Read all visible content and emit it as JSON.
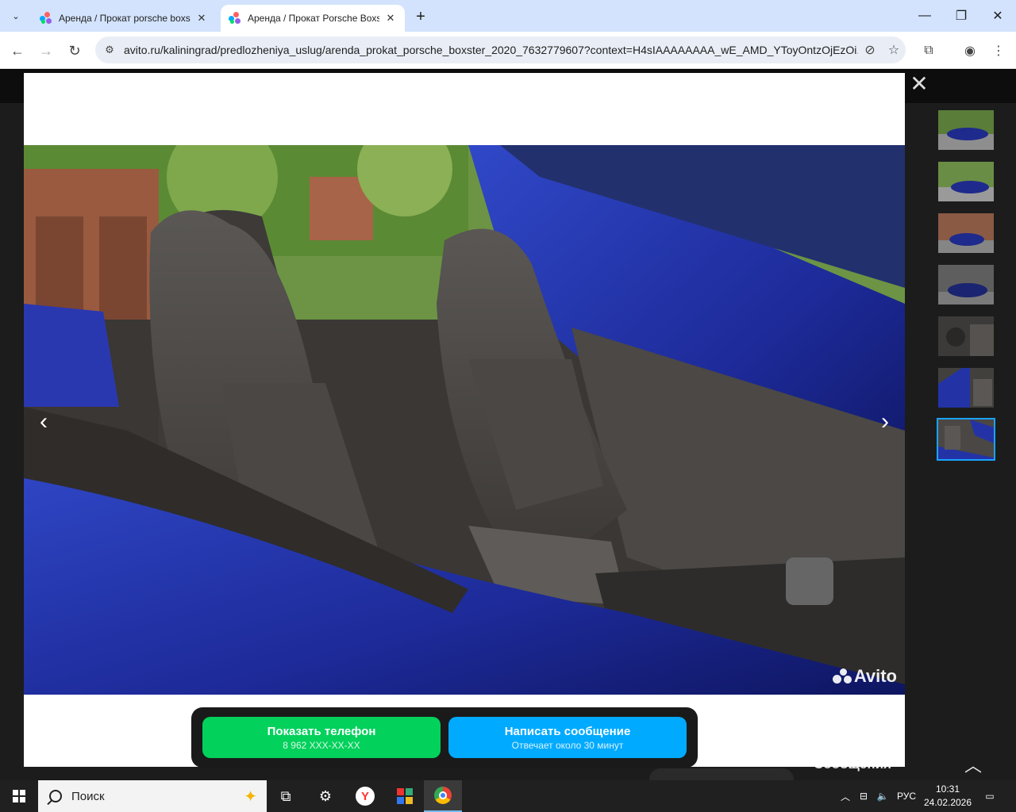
{
  "browser": {
    "tabs": [
      {
        "title": "Аренда / Прокат porsche boxster",
        "active": false
      },
      {
        "title": "Аренда / Прокат Porsche Boxster",
        "active": true
      }
    ],
    "url": "avito.ru/kaliningrad/predlozheniya_uslug/arenda_prokat_porsche_boxster_2020_7632779607?context=H4sIAAAAAAAA_wE_AMD_YToyOntzOjEzOi..."
  },
  "viewer": {
    "thumbnail_count": 7,
    "selected_thumbnail": 7,
    "watermark": "Avito",
    "photo_colors": {
      "body": "#2230a8",
      "leather": "#4a4744",
      "foliage": "#5c8a3a",
      "brick": "#9a5a40"
    }
  },
  "cta": {
    "phone_label": "Показать телефон",
    "phone_sub": "8 962 XXX-XX-XX",
    "message_label": "Написать сообщение",
    "message_sub": "Отвечает около 30 минут"
  },
  "background": {
    "messages_label": "Сообщения"
  },
  "taskbar": {
    "search_placeholder": "Поиск",
    "lang": "РУС",
    "time": "10:31",
    "date": "24.02.2026"
  }
}
